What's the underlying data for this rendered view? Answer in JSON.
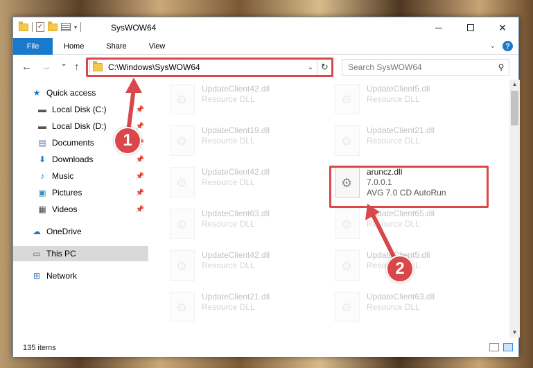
{
  "window": {
    "title": "SysWOW64",
    "controls": {
      "minimize": "—",
      "maximize": "☐",
      "close": "✕"
    }
  },
  "ribbon": {
    "tabs": [
      "File",
      "Home",
      "Share",
      "View"
    ],
    "help": "?"
  },
  "nav": {
    "back": "←",
    "forward": "→",
    "recent": "⌄",
    "up": "↑",
    "address": "C:\\Windows\\SysWOW64",
    "refresh": "↻",
    "search_placeholder": "Search SysWOW64"
  },
  "sidebar": {
    "items": [
      {
        "label": "Quick access",
        "icon": "star-icon",
        "pinned": false
      },
      {
        "label": "Local Disk (C:)",
        "icon": "drive-icon",
        "pinned": true
      },
      {
        "label": "Local Disk (D:)",
        "icon": "drive-icon",
        "pinned": true
      },
      {
        "label": "Documents",
        "icon": "documents-icon",
        "pinned": true
      },
      {
        "label": "Downloads",
        "icon": "downloads-icon",
        "pinned": true
      },
      {
        "label": "Music",
        "icon": "music-icon",
        "pinned": true
      },
      {
        "label": "Pictures",
        "icon": "pictures-icon",
        "pinned": true
      },
      {
        "label": "Videos",
        "icon": "videos-icon",
        "pinned": true
      },
      {
        "label": "OneDrive",
        "icon": "cloud-icon",
        "pinned": false
      },
      {
        "label": "This PC",
        "icon": "monitor-icon",
        "pinned": false,
        "selected": true
      },
      {
        "label": "Network",
        "icon": "network-icon",
        "pinned": false
      }
    ]
  },
  "files": [
    {
      "name": "UpdateClient42.dll",
      "desc": "Resource DLL"
    },
    {
      "name": "UpdateClient5.dll",
      "desc": "Resource DLL"
    },
    {
      "name": "UpdateClient19.dll",
      "desc": "Resource DLL"
    },
    {
      "name": "UpdateClient21.dll",
      "desc": "Resource DLL"
    },
    {
      "name": "UpdateClient42.dll",
      "desc": "Resource DLL"
    },
    {
      "name": "aruncz.dll",
      "version": "7.0.0.1",
      "desc": "AVG 7.0 CD AutoRun"
    },
    {
      "name": "UpdateClient63.dll",
      "desc": "Resource DLL"
    },
    {
      "name": "UpdateClient65.dll",
      "desc": "Resource DLL"
    },
    {
      "name": "UpdateClient42.dll",
      "desc": "Resource DLL"
    },
    {
      "name": "UpdateClient5.dll",
      "desc": "Resource DLL"
    },
    {
      "name": "UpdateClient21.dll",
      "desc": "Resource DLL"
    },
    {
      "name": "UpdateClient63.dll",
      "desc": "Resource DLL"
    }
  ],
  "status": {
    "items": "135 items"
  },
  "callouts": {
    "one": "1",
    "two": "2"
  },
  "colors": {
    "accent": "#1979ca",
    "annotation": "#d9474b"
  }
}
